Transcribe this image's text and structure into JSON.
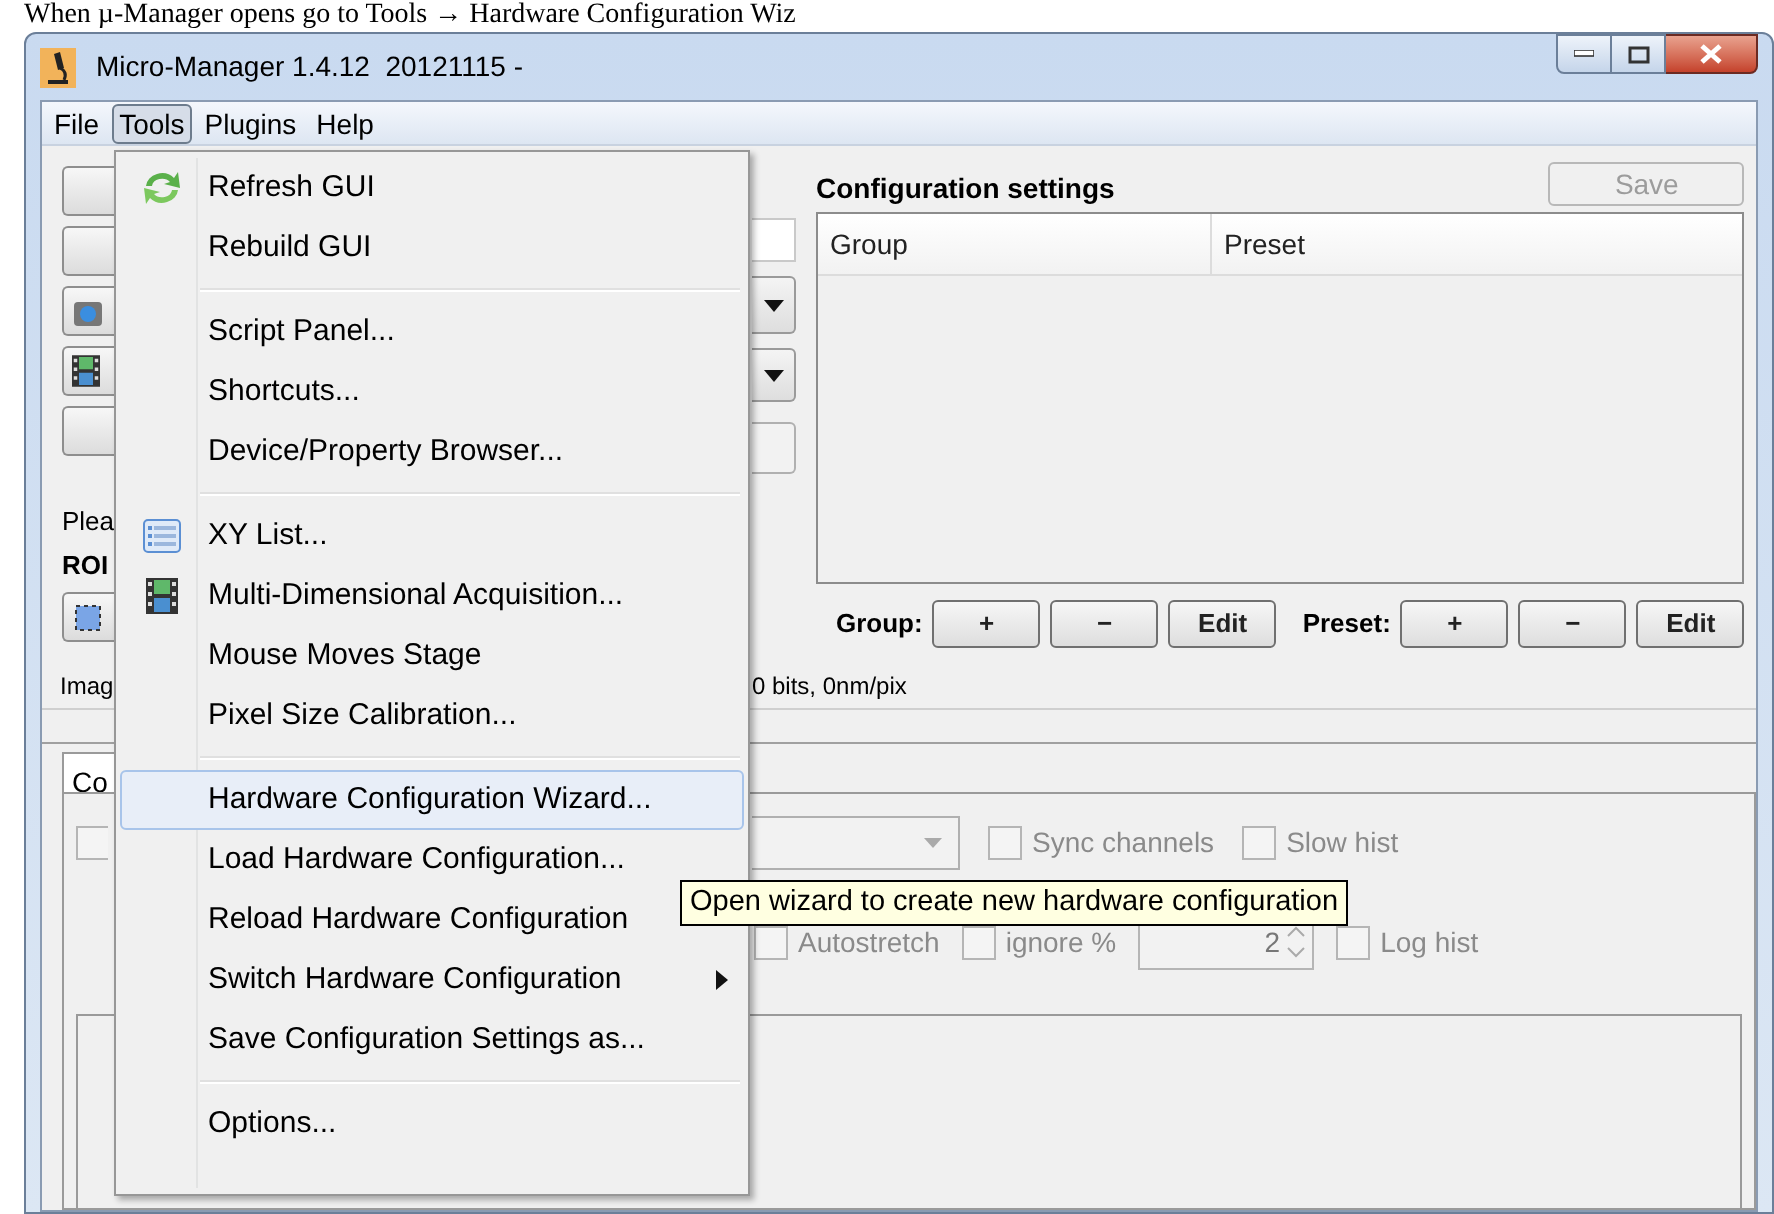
{
  "caption": "When µ-Manager opens go to Tools → Hardware Configuration Wiz",
  "window": {
    "title": "Micro-Manager 1.4.12  20121115 -"
  },
  "menubar": [
    {
      "label": "File",
      "selected": false
    },
    {
      "label": "Tools",
      "selected": true
    },
    {
      "label": "Plugins",
      "selected": false
    },
    {
      "label": "Help",
      "selected": false
    }
  ],
  "main_panel": {
    "left_labels": [
      {
        "kind": "plain",
        "text": "Plea"
      },
      {
        "kind": "bold",
        "text": "ROI"
      }
    ],
    "image_label": "Imag",
    "image_info": "0 bits, 0nm/pix"
  },
  "configuration": {
    "title": "Configuration settings",
    "save_button": {
      "label": "Save",
      "disabled": true
    },
    "columns": [
      "Group",
      "Preset"
    ],
    "group_label": "Group:",
    "group_buttons": [
      "+",
      "−",
      "Edit"
    ],
    "preset_label": "Preset:",
    "preset_buttons": [
      "+",
      "−",
      "Edit"
    ]
  },
  "lower_panel": {
    "tab": {
      "label": "Co",
      "selected": true
    },
    "left_checkbox": {
      "checked": false
    },
    "row_1": [
      {
        "label": "Sync channels",
        "checked": false
      },
      {
        "label": "Slow hist",
        "checked": false
      }
    ],
    "row_2": [
      {
        "kind": "checkbox",
        "label": "Autostretch",
        "checked": false
      },
      {
        "kind": "checkbox",
        "label": "ignore %",
        "checked": false
      },
      {
        "kind": "spinner",
        "value": "2"
      },
      {
        "kind": "checkbox",
        "label": "Log hist",
        "checked": false
      }
    ]
  },
  "tools_menu": [
    {
      "kind": "item",
      "label": "Refresh GUI",
      "selected": false,
      "submenu": false
    },
    {
      "kind": "item",
      "label": "Rebuild GUI",
      "selected": false,
      "submenu": false
    },
    {
      "kind": "separator"
    },
    {
      "kind": "item",
      "label": "Script Panel...",
      "selected": false,
      "submenu": false
    },
    {
      "kind": "item",
      "label": "Shortcuts...",
      "selected": false,
      "submenu": false
    },
    {
      "kind": "item",
      "label": "Device/Property Browser...",
      "selected": false,
      "submenu": false
    },
    {
      "kind": "separator"
    },
    {
      "kind": "item",
      "label": "XY List...",
      "selected": false,
      "submenu": false
    },
    {
      "kind": "item",
      "label": "Multi-Dimensional Acquisition...",
      "selected": false,
      "submenu": false
    },
    {
      "kind": "item",
      "label": "Mouse Moves Stage",
      "selected": false,
      "submenu": false
    },
    {
      "kind": "item",
      "label": "Pixel Size Calibration...",
      "selected": false,
      "submenu": false
    },
    {
      "kind": "separator"
    },
    {
      "kind": "item",
      "label": "Hardware Configuration Wizard...",
      "selected": true,
      "submenu": false
    },
    {
      "kind": "item",
      "label": "Load Hardware Configuration...",
      "selected": false,
      "submenu": false
    },
    {
      "kind": "item",
      "label": "Reload Hardware Configuration",
      "selected": false,
      "submenu": false
    },
    {
      "kind": "item",
      "label": "Switch Hardware Configuration",
      "selected": false,
      "submenu": true
    },
    {
      "kind": "item",
      "label": "Save Configuration Settings as...",
      "selected": false,
      "submenu": false
    },
    {
      "kind": "separator"
    },
    {
      "kind": "item",
      "label": "Options...",
      "selected": false,
      "submenu": false
    }
  ],
  "tooltip": "Open wizard to create new hardware configuration"
}
